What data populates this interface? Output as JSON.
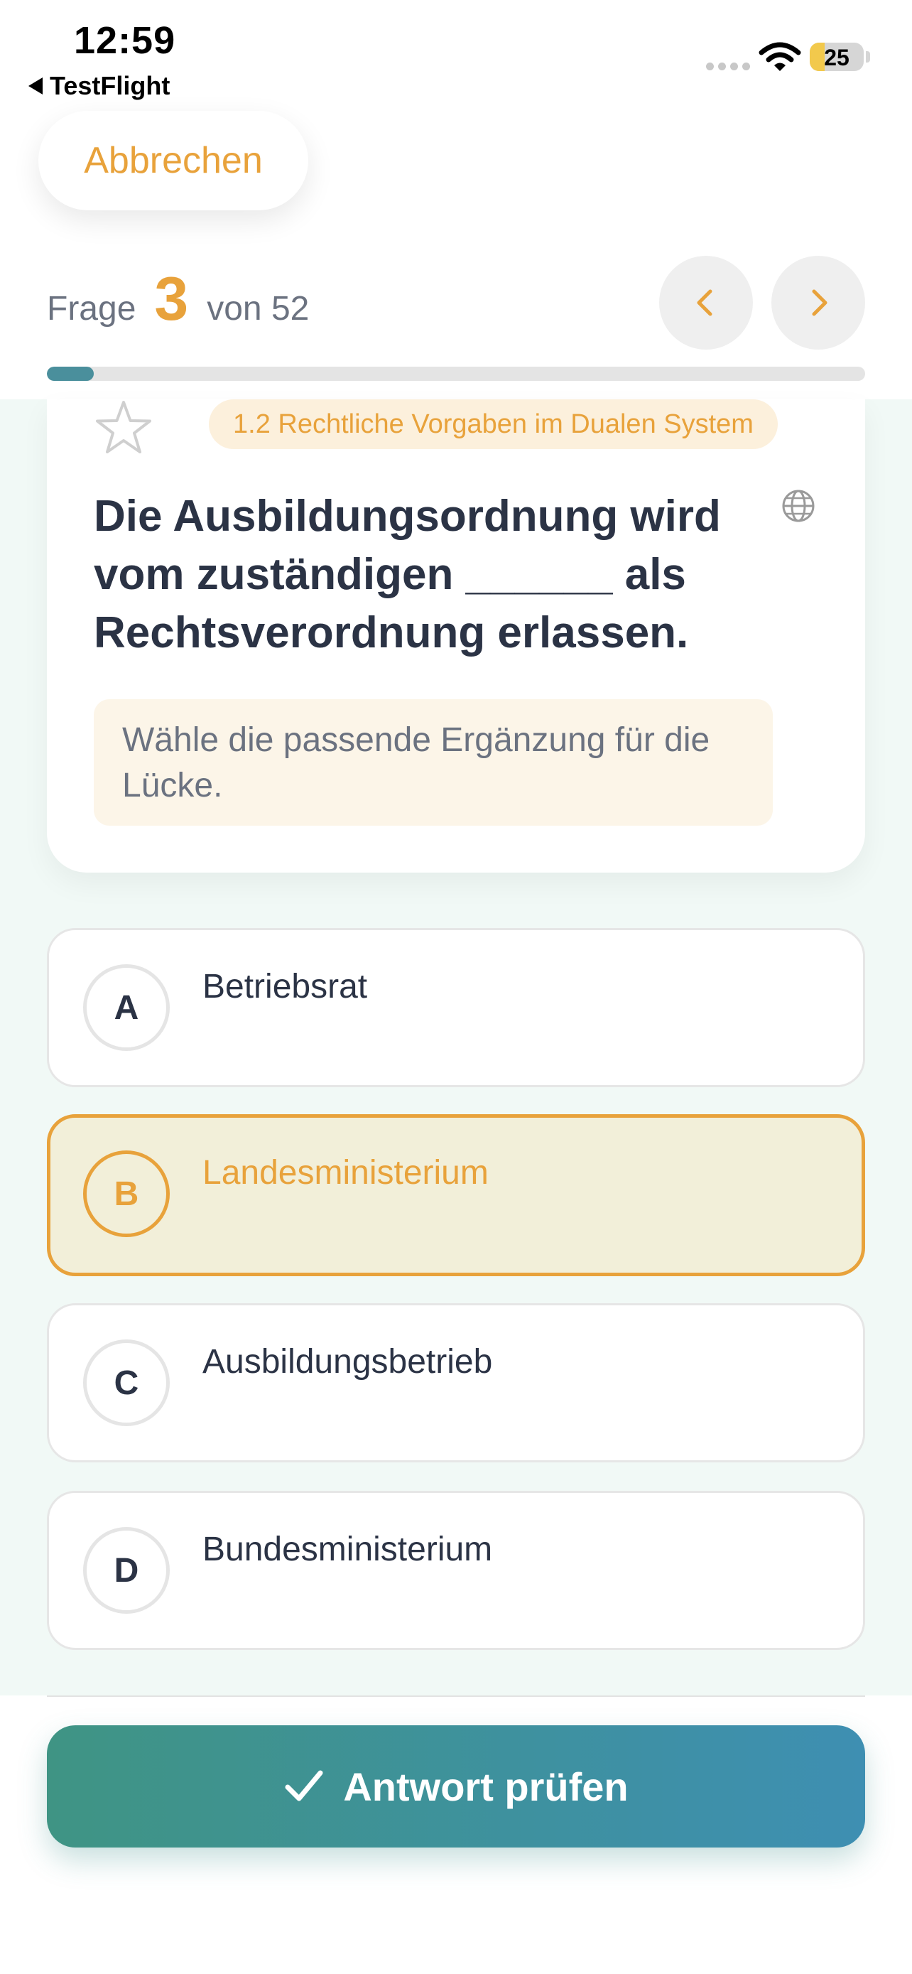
{
  "status_bar": {
    "time": "12:59",
    "back_label": "TestFlight",
    "battery": "25",
    "icons": [
      "signal-icon",
      "wifi-icon",
      "battery-icon"
    ]
  },
  "header": {
    "cancel_label": "Abbrechen",
    "question_prefix": "Frage",
    "question_number": "3",
    "question_suffix": "von 52",
    "progress_fraction": 0.0577,
    "prev_icon": "chevron-left-icon",
    "next_icon": "chevron-right-icon"
  },
  "question": {
    "topic": "1.2 Rechtliche Vorgaben im Dualen System",
    "text": "Die Ausbildungsordnung wird vom zuständigen ______ als Rechtsverordnung erlassen.",
    "hint": "Wähle die passende Ergänzung für die Lücke.",
    "favorite_icon": "star-outline-icon",
    "translate_icon": "globe-icon"
  },
  "answers": [
    {
      "letter": "A",
      "text": "Betriebsrat",
      "selected": false
    },
    {
      "letter": "B",
      "text": "Landesministerium",
      "selected": true
    },
    {
      "letter": "C",
      "text": "Ausbildungsbetrieb",
      "selected": false
    },
    {
      "letter": "D",
      "text": "Bundesministerium",
      "selected": false
    }
  ],
  "footer": {
    "check_label": "Antwort prüfen",
    "check_icon": "checkmark-icon"
  },
  "colors": {
    "accent": "#e8a23b",
    "teal": "#4a8f9c",
    "content_bg": "#f1f9f6",
    "button_gradient": [
      "#3f9484",
      "#3e8fb2"
    ]
  }
}
